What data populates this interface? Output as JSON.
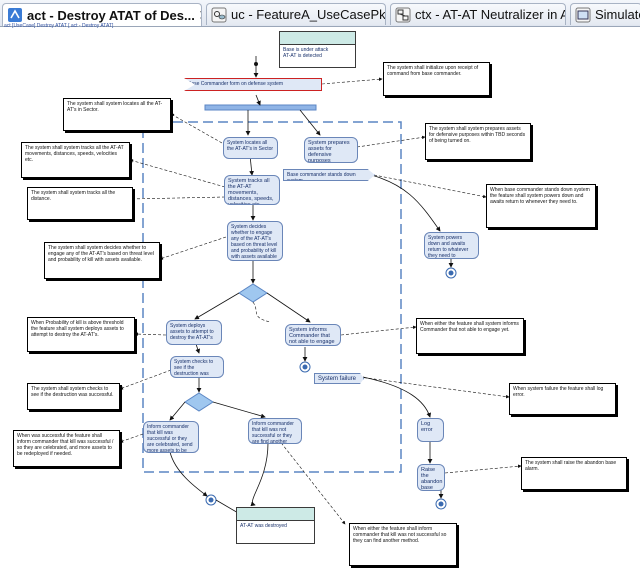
{
  "tabs": [
    {
      "label": "act - Destroy ATAT of Des...",
      "icon": "activity-diagram-icon",
      "active": true,
      "closable": true
    },
    {
      "label": "uc - FeatureA_UseCasePkg i...",
      "icon": "use-case-diagram-icon",
      "active": false
    },
    {
      "label": "ctx - AT-AT Neutralizer in AT-...",
      "icon": "context-diagram-icon",
      "active": false
    },
    {
      "label": "Simulate",
      "icon": "simulation-icon",
      "active": false
    }
  ],
  "breadcrumb": "act [UseCase] Destroy ATAT [ act - Destroy ATAT]",
  "colors": {
    "action_fill": "#dfe8f6",
    "action_border": "#6a86b8",
    "class_header": "#cdeae6",
    "signal_accent": "#cc2222",
    "swimlane_dash": "#5b86c4"
  },
  "diagram": {
    "objects": {
      "top": "Base is under attack\nAT-AT is detected",
      "bottom": "AT-AT was destroyed"
    },
    "signals": {
      "order": "Base Commander form on defense system",
      "stand_down": "Base commander stands down system",
      "failure": "System failure"
    },
    "actions": {
      "gather": "System locates all the AT-AT's in Sector",
      "prepare": "System prepares assets for defensive purposes",
      "track": "System tracks all the AT-AT movements, distances, speeds, velocities etc.",
      "decide": "System decides whether to engage any of the AT-AT's based on threat level and probability of kill with assets available",
      "deploy": "System deploys assets to attempt to destroy the AT-AT's",
      "check": "System checks to see if the destruction was successful",
      "inform_fail": "System informs Commander that not able to engage yet",
      "inform_ok": "Inform commander that kill was successful or they are celebrated, send more assets to be redeployed if needed",
      "inform_unsure": "Inform commander that kill was not successful or they are find another method",
      "powers_down": "System powers down and awaits return to whatever they need to",
      "log_error": "Log error",
      "raise_alarm": "Raise the abandon base alarm"
    },
    "notes": {
      "n_order": "The system shall initialize upon receipt of command from base commander.",
      "n_gather": "The system shall system locates all the AT-AT's in Sector.",
      "n_prepare": "The system shall system prepares assets for defensive purposes within TBD seconds of being turned on.",
      "n_track": "The system shall system tracks all the AT-AT movements, distances, speeds, velocities etc.",
      "n_distance": "The system shall system tracks all the distance.",
      "n_standdown": "When base commander stands down system the feature shall system powers down and awaits return to whenever they need to.",
      "n_decide": "The system shall system decides whether to engage any of the AT-AT's based on threat level and probability of kill with assets available.",
      "n_prob": "When Probability of kill is above threshold the feature shall system deploys assets to attempt to destroy the AT-AT's.",
      "n_inform_fail": "When either the feature shall system informs Commander that not able to engage yet.",
      "n_check": "The system shall system checks to see if the destruction was successful.",
      "n_failure": "When system failure the feature shall log error.",
      "n_ok": "When was successful the feature shall inform commander that kill was successful / so they are celebrated, and more assets to be redeployed if needed.",
      "n_alarm": "The system shall raise the abandon base alarm.",
      "n_unsure": "When either the feature shall inform commander that kill was not successful so they can find another method."
    }
  }
}
